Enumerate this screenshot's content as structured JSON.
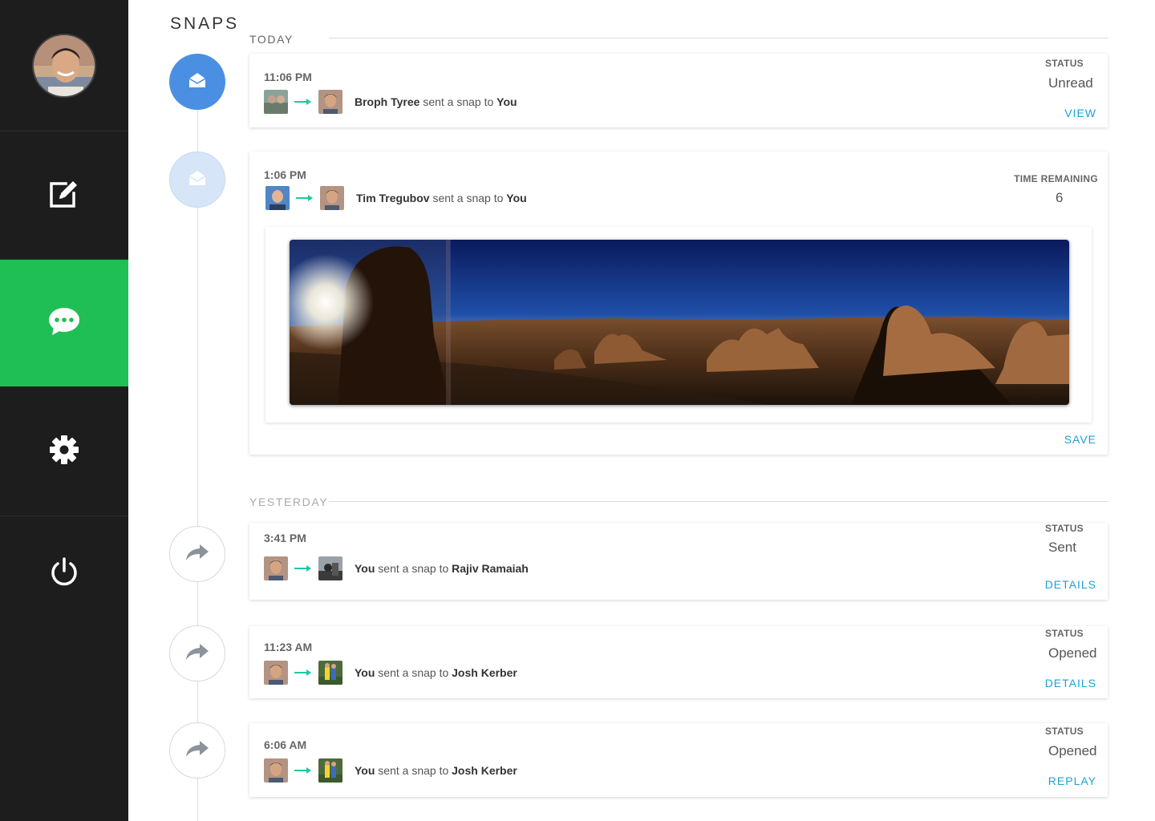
{
  "page": {
    "title": "SNAPS"
  },
  "sidebar": {
    "items": [
      {
        "name": "profile",
        "icon": "user-avatar"
      },
      {
        "name": "compose",
        "icon": "compose-icon"
      },
      {
        "name": "messages",
        "icon": "chat-bubble-icon",
        "active": true
      },
      {
        "name": "settings",
        "icon": "gear-icon"
      },
      {
        "name": "logout",
        "icon": "power-icon"
      }
    ],
    "active_color": "#20bf55"
  },
  "sections": {
    "today": "TODAY",
    "yesterday": "YESTERDAY"
  },
  "snaps": [
    {
      "time": "11:06 PM",
      "sender": "Broph Tyree",
      "middle": "sent a snap to",
      "recipient": "You",
      "status_label": "STATUS",
      "status_value": "Unread",
      "action": "VIEW",
      "node_icon": "envelope-open-icon"
    },
    {
      "time": "1:06 PM",
      "sender": "Tim Tregubov",
      "middle": "sent a snap to",
      "recipient": "You",
      "status_label": "TIME REMAINING",
      "status_value": "6",
      "action": "SAVE",
      "node_icon": "envelope-open-icon"
    },
    {
      "time": "3:41 PM",
      "sender": "You",
      "middle": "sent a snap to",
      "recipient": "Rajiv Ramaiah",
      "status_label": "STATUS",
      "status_value": "Sent",
      "action": "DETAILS",
      "node_icon": "share-arrow-icon"
    },
    {
      "time": "11:23 AM",
      "sender": "You",
      "middle": "sent a snap to",
      "recipient": "Josh Kerber",
      "status_label": "STATUS",
      "status_value": "Opened",
      "action": "DETAILS",
      "node_icon": "share-arrow-icon"
    },
    {
      "time": "6:06 AM",
      "sender": "You",
      "middle": "sent a snap to",
      "recipient": "Josh Kerber",
      "status_label": "STATUS",
      "status_value": "Opened",
      "action": "REPLAY",
      "node_icon": "share-arrow-icon"
    }
  ],
  "colors": {
    "accent_link": "#1fa1d6",
    "arrow": "#1ec9a0",
    "node_unread": "#4a8fe2",
    "node_pending": "#d6e6f8"
  }
}
